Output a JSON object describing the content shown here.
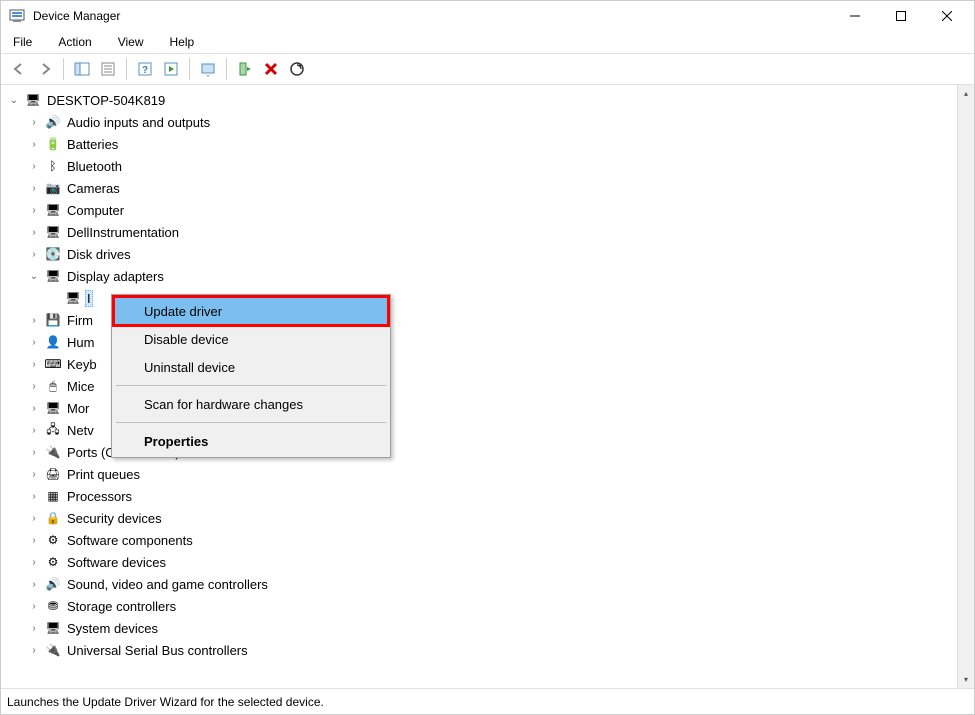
{
  "window": {
    "title": "Device Manager"
  },
  "menubar": {
    "items": [
      "File",
      "Action",
      "View",
      "Help"
    ]
  },
  "tree": {
    "root": "DESKTOP-504K819",
    "children": [
      {
        "label": "Audio inputs and outputs",
        "icon": "🔊"
      },
      {
        "label": "Batteries",
        "icon": "🔋"
      },
      {
        "label": "Bluetooth",
        "icon": "ᛒ"
      },
      {
        "label": "Cameras",
        "icon": "📷"
      },
      {
        "label": "Computer",
        "icon": "🖥"
      },
      {
        "label": "DellInstrumentation",
        "icon": "🖥"
      },
      {
        "label": "Disk drives",
        "icon": "💽"
      },
      {
        "label": "Display adapters",
        "icon": "🖥",
        "expanded": true,
        "children": [
          {
            "label": "I",
            "icon": "🖥",
            "selected": true
          }
        ]
      },
      {
        "label": "Firm",
        "icon": "💾"
      },
      {
        "label": "Hum",
        "icon": "👤"
      },
      {
        "label": "Keyb",
        "icon": "⌨"
      },
      {
        "label": "Mice",
        "icon": "🖱"
      },
      {
        "label": "Mor",
        "icon": "🖥"
      },
      {
        "label": "Netv",
        "icon": "🖧"
      },
      {
        "label": "Ports (COM & LPT)",
        "icon": "🔌"
      },
      {
        "label": "Print queues",
        "icon": "🖨"
      },
      {
        "label": "Processors",
        "icon": "▦"
      },
      {
        "label": "Security devices",
        "icon": "🔒"
      },
      {
        "label": "Software components",
        "icon": "⚙"
      },
      {
        "label": "Software devices",
        "icon": "⚙"
      },
      {
        "label": "Sound, video and game controllers",
        "icon": "🔊"
      },
      {
        "label": "Storage controllers",
        "icon": "⛃"
      },
      {
        "label": "System devices",
        "icon": "🖥"
      },
      {
        "label": "Universal Serial Bus controllers",
        "icon": "🔌"
      }
    ]
  },
  "context_menu": {
    "items": [
      {
        "label": "Update driver",
        "highlighted": true
      },
      {
        "label": "Disable device"
      },
      {
        "label": "Uninstall device"
      },
      {
        "sep": true
      },
      {
        "label": "Scan for hardware changes"
      },
      {
        "sep": true
      },
      {
        "label": "Properties",
        "bold": true
      }
    ]
  },
  "statusbar": {
    "text": "Launches the Update Driver Wizard for the selected device."
  }
}
